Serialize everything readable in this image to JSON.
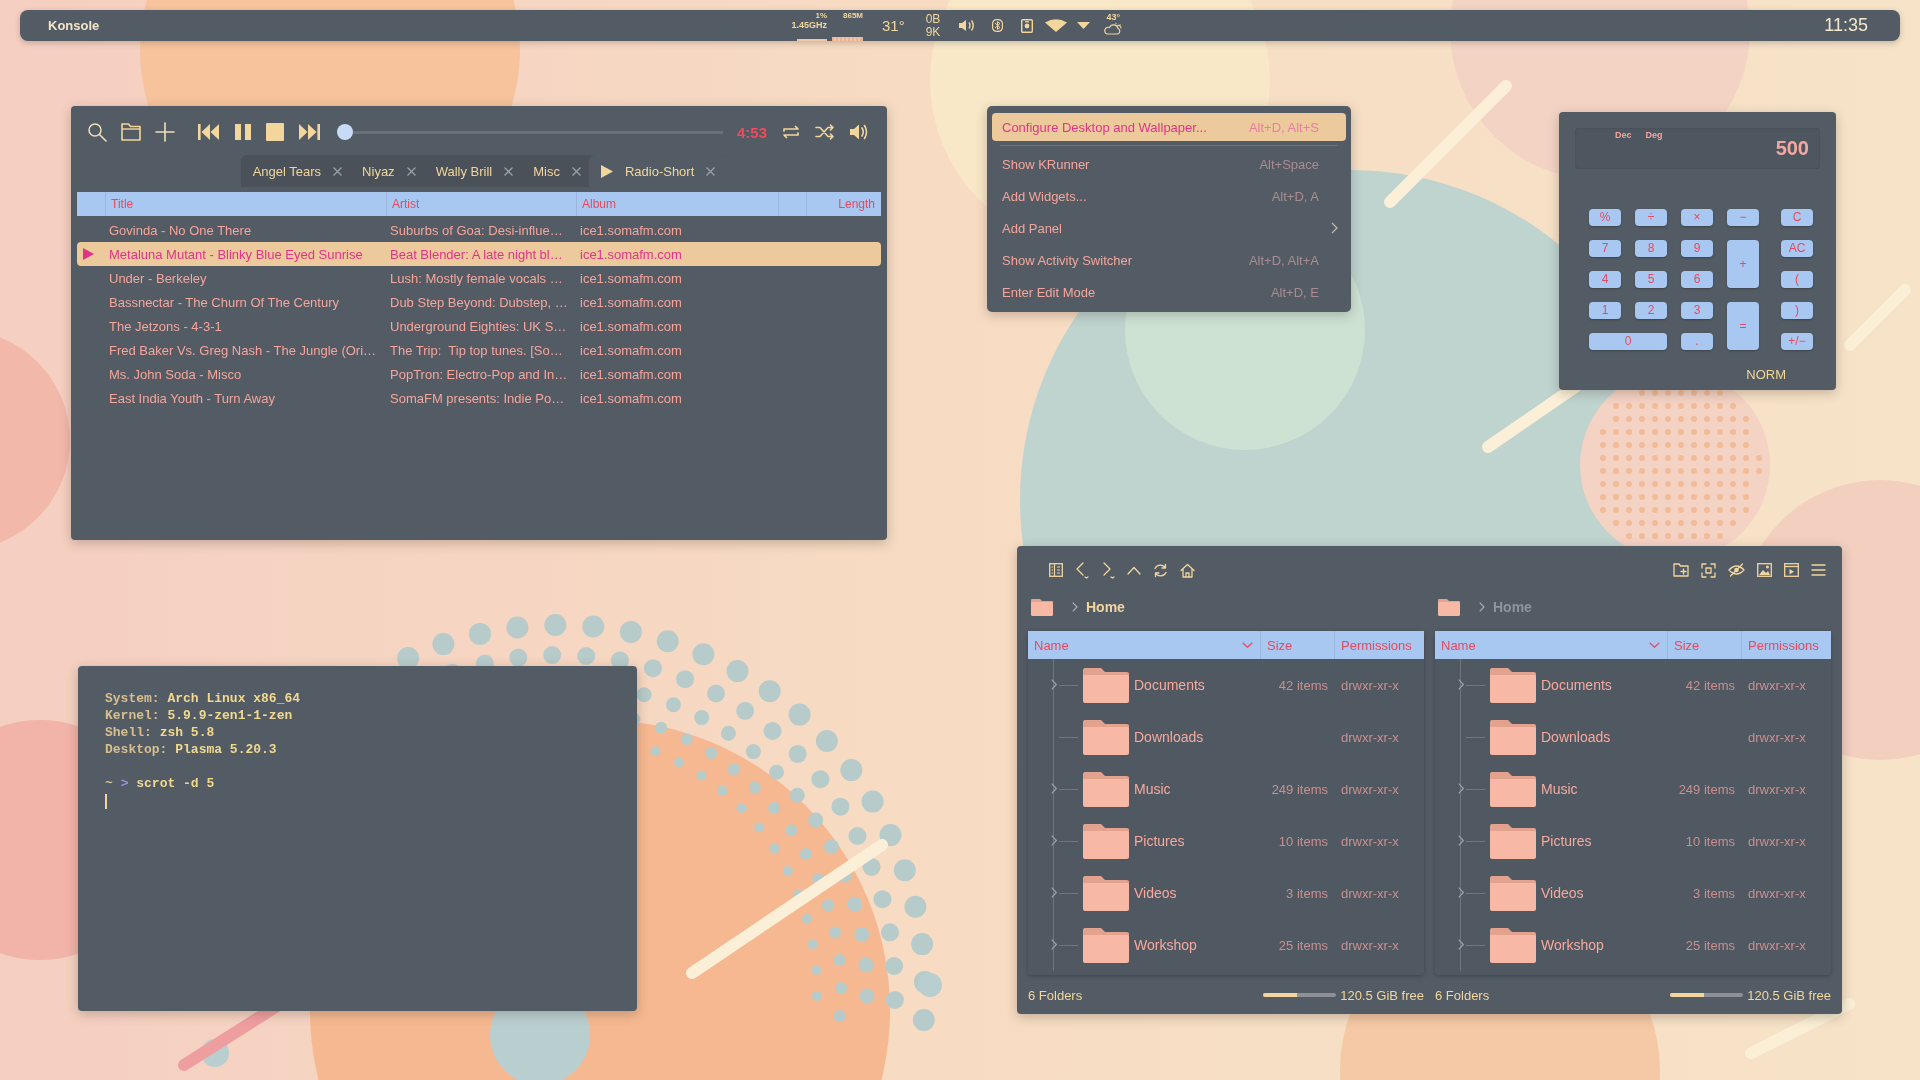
{
  "panel": {
    "app_title": "Konsole",
    "cpu_usage": "1%",
    "cpu_clock": "1.45GHz",
    "memory": "865M",
    "cpu_temperature": "31°",
    "net_upload": "0B",
    "net_download": "9K",
    "weather_temperature": "43°",
    "clock": "11:35"
  },
  "music_player": {
    "seek": {
      "level": 0
    },
    "elapsed": "4:53",
    "tabs": [
      {
        "label": "Angel Tears",
        "selected": false,
        "playing": false
      },
      {
        "label": "Niyaz",
        "selected": false,
        "playing": false
      },
      {
        "label": "Wally Brill",
        "selected": false,
        "playing": false
      },
      {
        "label": "Misc",
        "selected": false,
        "playing": false
      },
      {
        "label": "Radio-Short",
        "selected": true,
        "playing": true
      }
    ],
    "columns": [
      "Title",
      "Artist",
      "Album",
      "Length"
    ],
    "rows": [
      {
        "title": "Govinda - No One There",
        "artist": "Suburbs of Goa: Desi-influe…",
        "album": "ice1.somafm.com",
        "selected": false,
        "playing": false
      },
      {
        "title": "Metaluna Mutant - Blinky Blue Eyed Sunrise",
        "artist": "Beat Blender: A late night bl…",
        "album": "ice1.somafm.com",
        "selected": true,
        "playing": true
      },
      {
        "title": "Under - Berkeley",
        "artist": "Lush: Mostly female vocals …",
        "album": "ice1.somafm.com",
        "selected": false,
        "playing": false
      },
      {
        "title": "Bassnectar - The Churn Of The Century",
        "artist": "Dub Step Beyond: Dubstep, …",
        "album": "ice1.somafm.com",
        "selected": false,
        "playing": false
      },
      {
        "title": "The Jetzons - 4-3-1",
        "artist": "Underground Eighties: UK S…",
        "album": "ice1.somafm.com",
        "selected": false,
        "playing": false
      },
      {
        "title": "Fred Baker Vs. Greg Nash - The Jungle (Ori…",
        "artist": "The Trip:  Tip top tunes. [So…",
        "album": "ice1.somafm.com",
        "selected": false,
        "playing": false
      },
      {
        "title": "Ms. John Soda - Misco",
        "artist": "PopTron: Electro-Pop and In…",
        "album": "ice1.somafm.com",
        "selected": false,
        "playing": false
      },
      {
        "title": "East India Youth - Turn Away",
        "artist": "SomaFM presents: Indie Po…",
        "album": "ice1.somafm.com",
        "selected": false,
        "playing": false
      }
    ]
  },
  "context_menu": {
    "items": [
      {
        "kind": "action",
        "label": "Configure Desktop and Wallpaper...",
        "shortcut": "Alt+D, Alt+S",
        "selected": true,
        "submenu": false
      },
      {
        "kind": "separator"
      },
      {
        "kind": "action",
        "label": "Show KRunner",
        "shortcut": "Alt+Space",
        "selected": false,
        "submenu": false
      },
      {
        "kind": "action",
        "label": "Add Widgets...",
        "shortcut": "Alt+D, A",
        "selected": false,
        "submenu": false
      },
      {
        "kind": "action",
        "label": "Add Panel",
        "selected": false,
        "submenu": true
      },
      {
        "kind": "action",
        "label": "Show Activity Switcher",
        "shortcut": "Alt+D, Alt+A",
        "selected": false,
        "submenu": false
      },
      {
        "kind": "action",
        "label": "Enter Edit Mode",
        "shortcut": "Alt+D, E",
        "selected": false,
        "submenu": false
      }
    ]
  },
  "calculator": {
    "indicators": [
      "Dec",
      "Deg"
    ],
    "display": "500",
    "keys": [
      {
        "label": "%",
        "kind": "key"
      },
      {
        "label": "÷",
        "kind": "key"
      },
      {
        "label": "×",
        "kind": "key"
      },
      {
        "label": "−",
        "kind": "key"
      },
      {
        "label": "C",
        "kind": "key"
      },
      {
        "label": "7",
        "kind": "key"
      },
      {
        "label": "8",
        "kind": "key"
      },
      {
        "label": "9",
        "kind": "key"
      },
      {
        "label": "+",
        "kind": "tall"
      },
      {
        "label": "AC",
        "kind": "key"
      },
      {
        "label": "4",
        "kind": "key"
      },
      {
        "label": "5",
        "kind": "key"
      },
      {
        "label": "6",
        "kind": "key"
      },
      {
        "label": "(",
        "kind": "key"
      },
      {
        "label": "1",
        "kind": "key"
      },
      {
        "label": "2",
        "kind": "key"
      },
      {
        "label": "3",
        "kind": "key"
      },
      {
        "label": "=",
        "kind": "tall"
      },
      {
        "label": ")",
        "kind": "key"
      },
      {
        "label": "0",
        "kind": "wide"
      },
      {
        "label": ".",
        "kind": "key"
      },
      {
        "label": "+/−",
        "kind": "key"
      }
    ],
    "mode": "NORM"
  },
  "terminal": {
    "lines": [
      {
        "label": "System:",
        "value": "Arch Linux x86_64"
      },
      {
        "label": "Kernel:",
        "value": "5.9.9-zen1-1-zen"
      },
      {
        "label": "Shell:",
        "value": "zsh 5.8"
      },
      {
        "label": "Desktop:",
        "value": "Plasma 5.20.3"
      }
    ],
    "prompt": {
      "directory": "~",
      "symbol": ">",
      "command": "scrot -d 5"
    }
  },
  "file_manager": {
    "panes": [
      {
        "active": true,
        "breadcrumb": "Home",
        "columns": [
          {
            "label": "Name",
            "sorted": true
          },
          {
            "label": "Size",
            "sorted": false
          },
          {
            "label": "Permissions",
            "sorted": false
          }
        ],
        "rows": [
          {
            "name": "Documents",
            "size": "42 items",
            "permissions": "drwxr-xr-x",
            "expandable": true
          },
          {
            "name": "Downloads",
            "permissions": "drwxr-xr-x",
            "expandable": false
          },
          {
            "name": "Music",
            "size": "249 items",
            "permissions": "drwxr-xr-x",
            "expandable": true
          },
          {
            "name": "Pictures",
            "size": "10 items",
            "permissions": "drwxr-xr-x",
            "expandable": true
          },
          {
            "name": "Videos",
            "size": "3 items",
            "permissions": "drwxr-xr-x",
            "expandable": true
          },
          {
            "name": "Workshop",
            "size": "25 items",
            "permissions": "drwxr-xr-x",
            "expandable": true
          }
        ],
        "status": "6 Folders",
        "free_space": {
          "level": 0.46
        },
        "free_text": "120.5 GiB free"
      },
      {
        "active": false,
        "breadcrumb": "Home",
        "columns": [
          {
            "label": "Name",
            "sorted": true
          },
          {
            "label": "Size",
            "sorted": false
          },
          {
            "label": "Permissions",
            "sorted": false
          }
        ],
        "rows": [
          {
            "name": "Documents",
            "size": "42 items",
            "permissions": "drwxr-xr-x",
            "expandable": true
          },
          {
            "name": "Downloads",
            "permissions": "drwxr-xr-x",
            "expandable": false
          },
          {
            "name": "Music",
            "size": "249 items",
            "permissions": "drwxr-xr-x",
            "expandable": true
          },
          {
            "name": "Pictures",
            "size": "10 items",
            "permissions": "drwxr-xr-x",
            "expandable": true
          },
          {
            "name": "Videos",
            "size": "3 items",
            "permissions": "drwxr-xr-x",
            "expandable": true
          },
          {
            "name": "Workshop",
            "size": "25 items",
            "permissions": "drwxr-xr-x",
            "expandable": true
          }
        ],
        "status": "6 Folders",
        "free_space": {
          "level": 0.47
        },
        "free_text": "120.5 GiB free"
      }
    ]
  }
}
